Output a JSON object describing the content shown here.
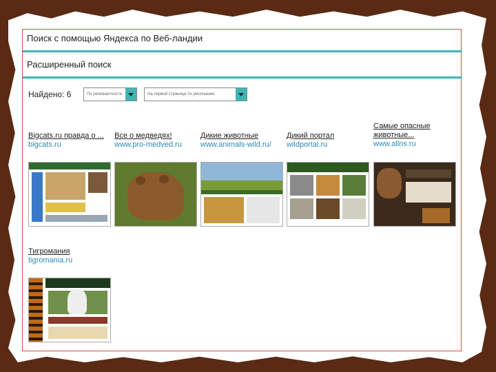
{
  "header": {
    "title": "Поиск с помощью Яндекса по Веб-ландии",
    "subtitle": "Расширенный поиск"
  },
  "filters": {
    "found_label": "Найдено: 6",
    "select1": "По релевантности",
    "select2": "На первой странице по умолчанию"
  },
  "colors": {
    "accent": "#3fb5b5",
    "border": "#d84b4b",
    "link": "#2a8bb5",
    "background": "#5a2a14"
  },
  "results": [
    {
      "title": "Bigcats.ru   правда о ...",
      "url": "bigcats.ru"
    },
    {
      "title": "Все о медведях!",
      "url": "www.pro-medved.ru"
    },
    {
      "title": "Дикие животные",
      "url": "www.animals-wild.ru/"
    },
    {
      "title": "Дикий портал",
      "url": "wildportal.ru"
    },
    {
      "title": "Самые опасные животные...",
      "url": "www.allns.ru"
    },
    {
      "title": "Тигромания",
      "url": "tigromania.ru"
    }
  ]
}
